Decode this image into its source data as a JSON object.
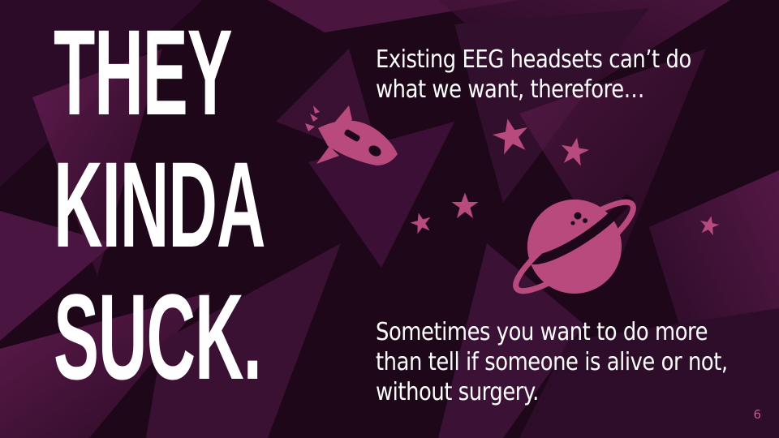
{
  "slide": {
    "headline_lines": [
      "THEY",
      "KINDA",
      "SUCK."
    ],
    "top_text_lines": [
      "Existing EEG headsets can’t do",
      "what we want, therefore…"
    ],
    "bottom_text_lines": [
      "Sometimes you want to do more",
      "than tell if someone is alive or not,",
      "without surgery."
    ],
    "page_number": "6"
  },
  "colors": {
    "background": "#1d0719",
    "accent": "#b84a7e",
    "text": "#ffffff",
    "page_number": "#c15b91"
  },
  "icons": [
    "rocket-icon",
    "planet-icon",
    "star-icon"
  ]
}
